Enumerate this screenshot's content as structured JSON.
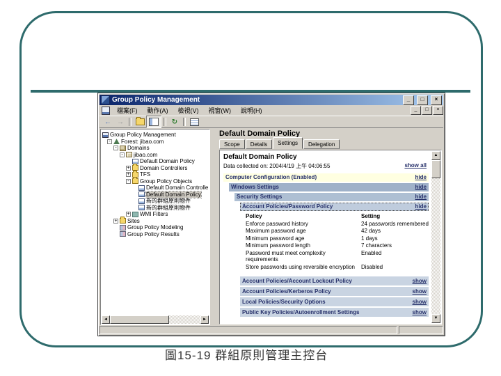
{
  "slide": {
    "caption": "圖15-19 群組原則管理主控台"
  },
  "colors": {
    "accent": "#2E6B6C",
    "titlebar_left": "#0A246A",
    "titlebar_right": "#A6CAF0",
    "section_yellow": "#FFFFE1",
    "section_blue_dark": "#9FB1C9",
    "section_blue_mid": "#AEBFD3",
    "section_blue_light": "#BFCCDD",
    "collapsed_blue": "#C9D4E2",
    "link_navy": "#26306a"
  },
  "window": {
    "title": "Group Policy Management",
    "controls": {
      "minimize": "_",
      "maximize": "□",
      "close": "×"
    },
    "child_controls": {
      "minimize": "_",
      "restore": "□",
      "close": "×"
    },
    "menu": {
      "items": [
        "檔案(F)",
        "動作(A)",
        "檢視(V)",
        "視窗(W)",
        "說明(H)"
      ]
    },
    "toolbar": {
      "icons": [
        "back",
        "forward",
        "up-folder",
        "console-tree",
        "refresh",
        "export-list"
      ]
    }
  },
  "tree": {
    "items": [
      {
        "label": "Group Policy Management"
      },
      {
        "label": "Forest: jibao.com",
        "toggle": "-"
      },
      {
        "label": "Domains",
        "toggle": "-"
      },
      {
        "label": "jibao.com",
        "toggle": "-"
      },
      {
        "label": "Default Domain Policy"
      },
      {
        "label": "Domain Controllers",
        "toggle": "+"
      },
      {
        "label": "TFS",
        "toggle": "+"
      },
      {
        "label": "Group Policy Objects",
        "toggle": "-"
      },
      {
        "label": "Default Domain Controlle"
      },
      {
        "label": "Default Domain Policy"
      },
      {
        "label": "新的群組原則物件"
      },
      {
        "label": "新的群組原則物件"
      },
      {
        "label": "WMI Filters",
        "toggle": "+"
      },
      {
        "label": "Sites",
        "toggle": "+"
      },
      {
        "label": "Group Policy Modeling"
      },
      {
        "label": "Group Policy Results"
      }
    ]
  },
  "content": {
    "pane_title": "Default Domain Policy",
    "tabs": [
      {
        "label": "Scope"
      },
      {
        "label": "Details"
      },
      {
        "label": "Settings"
      },
      {
        "label": "Delegation"
      }
    ],
    "report": {
      "title": "Default Domain Policy",
      "collected": "Data collected on: 2004/4/19 上午 04:06:55",
      "show_all_link": "show all",
      "sections": [
        {
          "label": "Computer Configuration (Enabled)",
          "link": "hide"
        },
        {
          "label": "Windows Settings",
          "link": "hide"
        },
        {
          "label": "Security Settings",
          "link": "hide"
        },
        {
          "label": "Account Policies/Password Policy",
          "link": "hide"
        }
      ],
      "table": {
        "headers": [
          "Policy",
          "Setting"
        ],
        "rows": [
          {
            "policy": "Enforce password history",
            "setting": "24 passwords remembered"
          },
          {
            "policy": "Maximum password age",
            "setting": "42 days"
          },
          {
            "policy": "Minimum password age",
            "setting": "1 days"
          },
          {
            "policy": "Minimum password length",
            "setting": "7 characters"
          },
          {
            "policy": "Password must meet complexity requirements",
            "setting": "Enabled"
          },
          {
            "policy": "Store passwords using reversible encryption",
            "setting": "Disabled"
          }
        ]
      },
      "collapsed": [
        {
          "label": "Account Policies/Account Lockout Policy",
          "link": "show"
        },
        {
          "label": "Account Policies/Kerberos Policy",
          "link": "show"
        },
        {
          "label": "Local Policies/Security Options",
          "link": "show"
        },
        {
          "label": "Public Key Policies/Autoenrollment Settings",
          "link": "show"
        }
      ]
    }
  }
}
